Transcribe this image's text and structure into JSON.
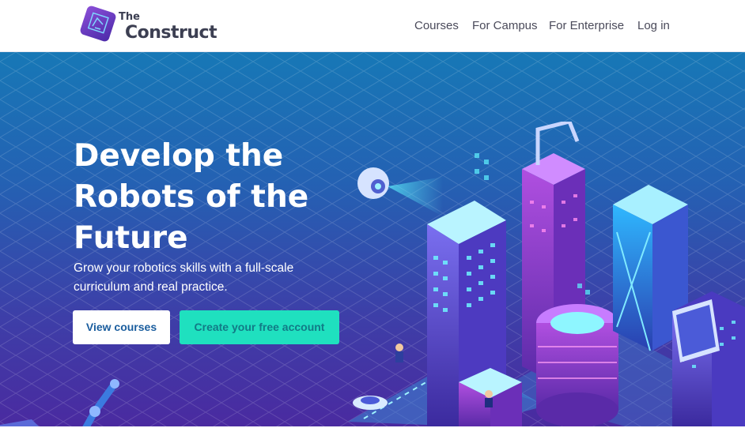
{
  "header": {
    "logo": {
      "line1": "The",
      "line2": "Construct"
    },
    "nav": [
      {
        "label": "Courses"
      },
      {
        "label": "For Campus"
      },
      {
        "label": "For Enterprise"
      },
      {
        "label": "Log in"
      }
    ]
  },
  "hero": {
    "headline": "Develop the Robots of the Future",
    "subheadline": "Grow your robotics skills with a full-scale curriculum and real practice.",
    "primary_button": "View courses",
    "secondary_button": "Create your free account"
  },
  "colors": {
    "header_bg": "#ffffff",
    "nav_text": "#4a4a5a",
    "hero_gradient_top": "#1778b6",
    "hero_gradient_bottom": "#4a2aa0",
    "primary_button_bg": "#ffffff",
    "primary_button_text": "#1a5d9e",
    "secondary_button_bg": "#1fe0bf",
    "secondary_button_text": "#127a86",
    "logo_mark": "#6a3cc7"
  },
  "icons": [
    "logo-mark-icon",
    "robot-city-illustration",
    "robotic-arm-illustration"
  ]
}
